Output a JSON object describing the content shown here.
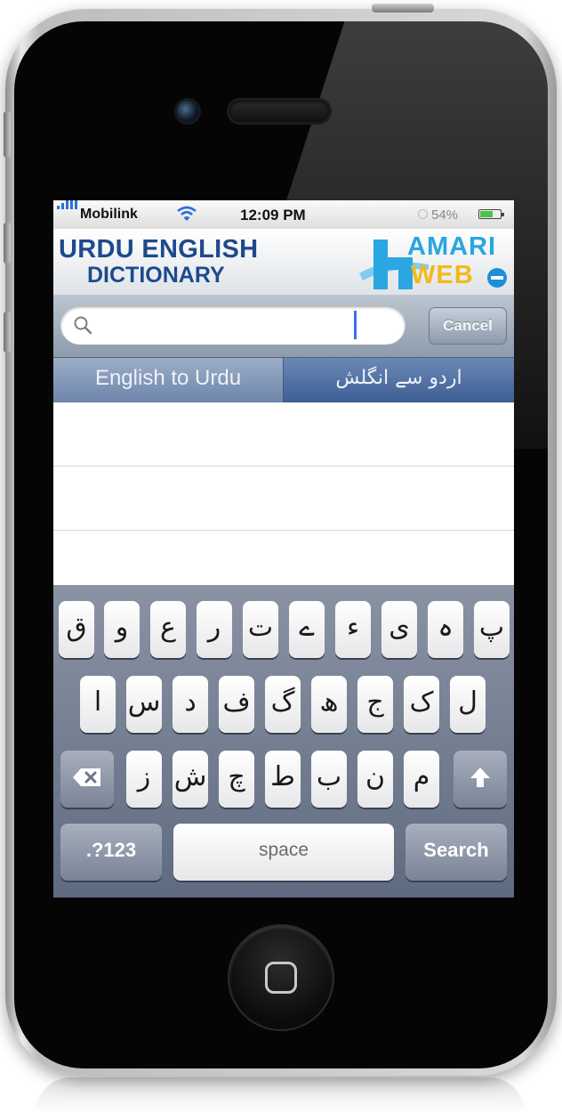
{
  "status_bar": {
    "carrier": "Mobilink",
    "time": "12:09 PM",
    "battery": "54%",
    "icons": [
      "signal-bars-icon",
      "wifi-icon",
      "sync-icon",
      "battery-icon"
    ]
  },
  "header": {
    "title_line1": "URDU ENGLISH",
    "title_line2": "DICTIONARY",
    "brand_word1": "AMARI",
    "brand_word2": "WEB"
  },
  "search": {
    "placeholder": "",
    "value": "",
    "cancel_label": "Cancel"
  },
  "tabs": [
    {
      "label": "English to Urdu",
      "selected": false
    },
    {
      "label": "اردو سے انگلش",
      "selected": true
    }
  ],
  "keyboard": {
    "row1": [
      "ق",
      "و",
      "ع",
      "ر",
      "ت",
      "ے",
      "ء",
      "ی",
      "ہ",
      "پ"
    ],
    "row2": [
      "ا",
      "س",
      "د",
      "ف",
      "گ",
      "ھ",
      "ج",
      "ک",
      "ل"
    ],
    "row3": [
      "ز",
      "ش",
      "چ",
      "ط",
      "ب",
      "ن",
      "م"
    ],
    "mode_label": ".?123",
    "space_label": "space",
    "search_label": "Search"
  },
  "colors": {
    "title_blue": "#1e4a8c",
    "brand_blue": "#2aa6e0",
    "brand_yellow": "#f4b81b",
    "tab_bar": "#4a6aa0",
    "caret": "#3a6ee8"
  }
}
